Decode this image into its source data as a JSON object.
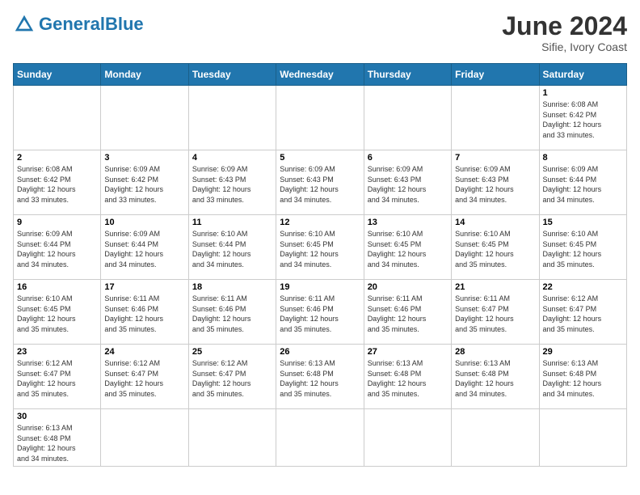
{
  "header": {
    "logo_general": "General",
    "logo_blue": "Blue",
    "month_title": "June 2024",
    "subtitle": "Sifie, Ivory Coast"
  },
  "days_of_week": [
    "Sunday",
    "Monday",
    "Tuesday",
    "Wednesday",
    "Thursday",
    "Friday",
    "Saturday"
  ],
  "weeks": [
    {
      "days": [
        {
          "num": "",
          "info": ""
        },
        {
          "num": "",
          "info": ""
        },
        {
          "num": "",
          "info": ""
        },
        {
          "num": "",
          "info": ""
        },
        {
          "num": "",
          "info": ""
        },
        {
          "num": "",
          "info": ""
        },
        {
          "num": "1",
          "info": "Sunrise: 6:08 AM\nSunset: 6:42 PM\nDaylight: 12 hours\nand 33 minutes."
        }
      ]
    },
    {
      "days": [
        {
          "num": "2",
          "info": "Sunrise: 6:08 AM\nSunset: 6:42 PM\nDaylight: 12 hours\nand 33 minutes."
        },
        {
          "num": "3",
          "info": "Sunrise: 6:09 AM\nSunset: 6:42 PM\nDaylight: 12 hours\nand 33 minutes."
        },
        {
          "num": "4",
          "info": "Sunrise: 6:09 AM\nSunset: 6:43 PM\nDaylight: 12 hours\nand 33 minutes."
        },
        {
          "num": "5",
          "info": "Sunrise: 6:09 AM\nSunset: 6:43 PM\nDaylight: 12 hours\nand 34 minutes."
        },
        {
          "num": "6",
          "info": "Sunrise: 6:09 AM\nSunset: 6:43 PM\nDaylight: 12 hours\nand 34 minutes."
        },
        {
          "num": "7",
          "info": "Sunrise: 6:09 AM\nSunset: 6:43 PM\nDaylight: 12 hours\nand 34 minutes."
        },
        {
          "num": "8",
          "info": "Sunrise: 6:09 AM\nSunset: 6:44 PM\nDaylight: 12 hours\nand 34 minutes."
        }
      ]
    },
    {
      "days": [
        {
          "num": "9",
          "info": "Sunrise: 6:09 AM\nSunset: 6:44 PM\nDaylight: 12 hours\nand 34 minutes."
        },
        {
          "num": "10",
          "info": "Sunrise: 6:09 AM\nSunset: 6:44 PM\nDaylight: 12 hours\nand 34 minutes."
        },
        {
          "num": "11",
          "info": "Sunrise: 6:10 AM\nSunset: 6:44 PM\nDaylight: 12 hours\nand 34 minutes."
        },
        {
          "num": "12",
          "info": "Sunrise: 6:10 AM\nSunset: 6:45 PM\nDaylight: 12 hours\nand 34 minutes."
        },
        {
          "num": "13",
          "info": "Sunrise: 6:10 AM\nSunset: 6:45 PM\nDaylight: 12 hours\nand 34 minutes."
        },
        {
          "num": "14",
          "info": "Sunrise: 6:10 AM\nSunset: 6:45 PM\nDaylight: 12 hours\nand 35 minutes."
        },
        {
          "num": "15",
          "info": "Sunrise: 6:10 AM\nSunset: 6:45 PM\nDaylight: 12 hours\nand 35 minutes."
        }
      ]
    },
    {
      "days": [
        {
          "num": "16",
          "info": "Sunrise: 6:10 AM\nSunset: 6:45 PM\nDaylight: 12 hours\nand 35 minutes."
        },
        {
          "num": "17",
          "info": "Sunrise: 6:11 AM\nSunset: 6:46 PM\nDaylight: 12 hours\nand 35 minutes."
        },
        {
          "num": "18",
          "info": "Sunrise: 6:11 AM\nSunset: 6:46 PM\nDaylight: 12 hours\nand 35 minutes."
        },
        {
          "num": "19",
          "info": "Sunrise: 6:11 AM\nSunset: 6:46 PM\nDaylight: 12 hours\nand 35 minutes."
        },
        {
          "num": "20",
          "info": "Sunrise: 6:11 AM\nSunset: 6:46 PM\nDaylight: 12 hours\nand 35 minutes."
        },
        {
          "num": "21",
          "info": "Sunrise: 6:11 AM\nSunset: 6:47 PM\nDaylight: 12 hours\nand 35 minutes."
        },
        {
          "num": "22",
          "info": "Sunrise: 6:12 AM\nSunset: 6:47 PM\nDaylight: 12 hours\nand 35 minutes."
        }
      ]
    },
    {
      "days": [
        {
          "num": "23",
          "info": "Sunrise: 6:12 AM\nSunset: 6:47 PM\nDaylight: 12 hours\nand 35 minutes."
        },
        {
          "num": "24",
          "info": "Sunrise: 6:12 AM\nSunset: 6:47 PM\nDaylight: 12 hours\nand 35 minutes."
        },
        {
          "num": "25",
          "info": "Sunrise: 6:12 AM\nSunset: 6:47 PM\nDaylight: 12 hours\nand 35 minutes."
        },
        {
          "num": "26",
          "info": "Sunrise: 6:13 AM\nSunset: 6:48 PM\nDaylight: 12 hours\nand 35 minutes."
        },
        {
          "num": "27",
          "info": "Sunrise: 6:13 AM\nSunset: 6:48 PM\nDaylight: 12 hours\nand 35 minutes."
        },
        {
          "num": "28",
          "info": "Sunrise: 6:13 AM\nSunset: 6:48 PM\nDaylight: 12 hours\nand 34 minutes."
        },
        {
          "num": "29",
          "info": "Sunrise: 6:13 AM\nSunset: 6:48 PM\nDaylight: 12 hours\nand 34 minutes."
        }
      ]
    },
    {
      "days": [
        {
          "num": "30",
          "info": "Sunrise: 6:13 AM\nSunset: 6:48 PM\nDaylight: 12 hours\nand 34 minutes."
        },
        {
          "num": "",
          "info": ""
        },
        {
          "num": "",
          "info": ""
        },
        {
          "num": "",
          "info": ""
        },
        {
          "num": "",
          "info": ""
        },
        {
          "num": "",
          "info": ""
        },
        {
          "num": "",
          "info": ""
        }
      ]
    }
  ]
}
